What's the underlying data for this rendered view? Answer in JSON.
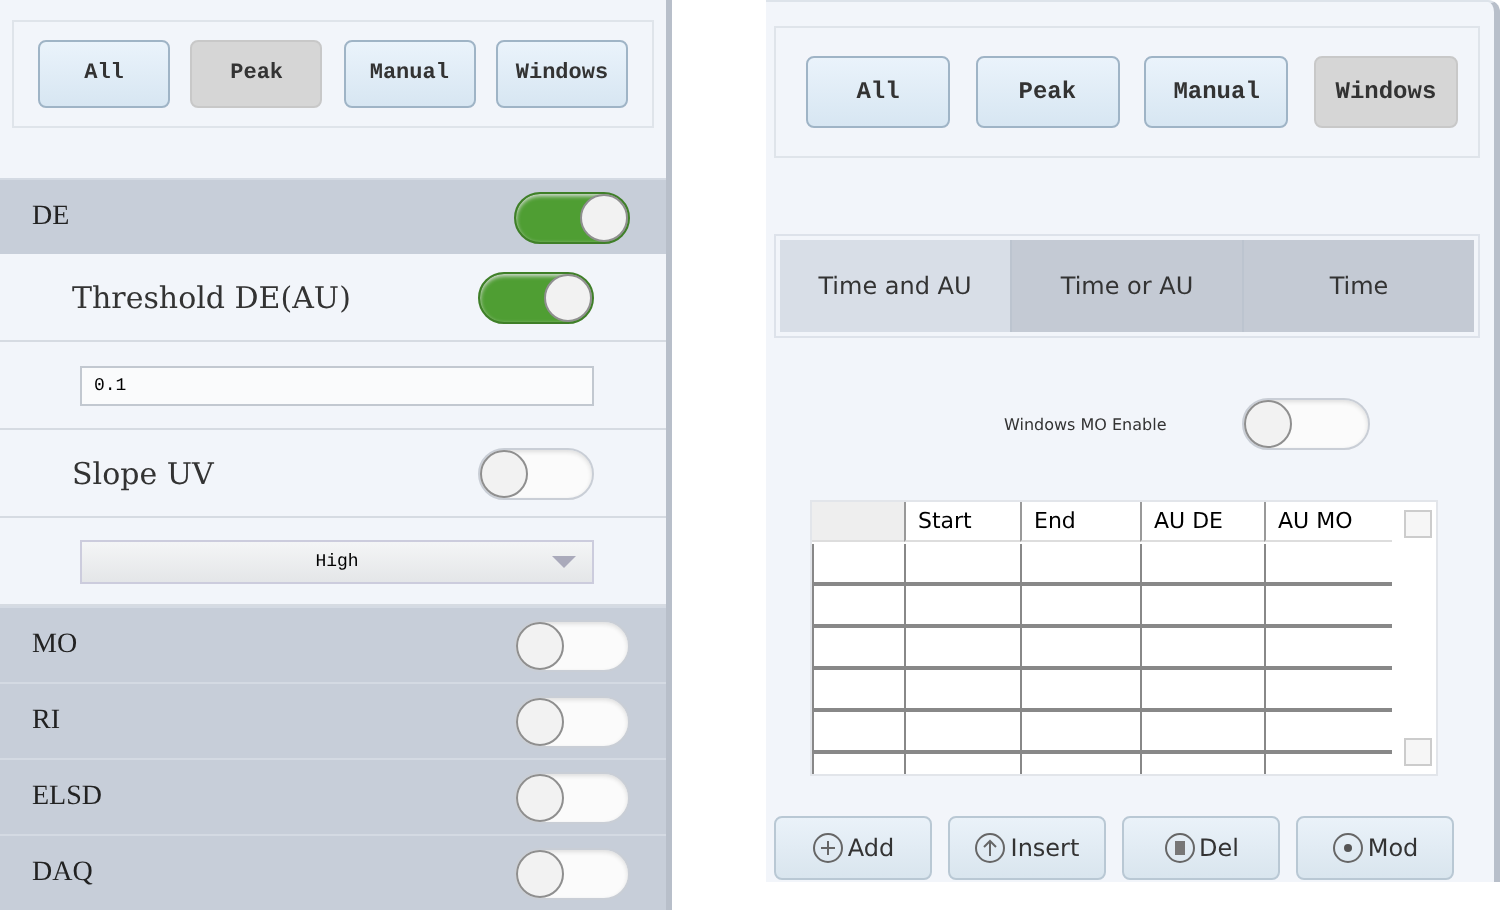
{
  "left_panel": {
    "modes": [
      {
        "label": "All",
        "selected": false
      },
      {
        "label": "Peak",
        "selected": true
      },
      {
        "label": "Manual",
        "selected": false
      },
      {
        "label": "Windows",
        "selected": false
      }
    ],
    "detectors": [
      {
        "name": "DE",
        "on": true,
        "settings": [
          {
            "kind": "toggle",
            "label": "Threshold DE(AU)",
            "on": true
          },
          {
            "kind": "input",
            "value": "0.1"
          },
          {
            "kind": "toggle",
            "label": "Slope UV",
            "on": false
          },
          {
            "kind": "select",
            "value": "High"
          }
        ]
      },
      {
        "name": "MO",
        "on": false
      },
      {
        "name": "RI",
        "on": false
      },
      {
        "name": "ELSD",
        "on": false
      },
      {
        "name": "DAQ",
        "on": false
      }
    ]
  },
  "right_panel": {
    "modes": [
      {
        "label": "All",
        "selected": false
      },
      {
        "label": "Peak",
        "selected": false
      },
      {
        "label": "Manual",
        "selected": false
      },
      {
        "label": "Windows",
        "selected": true
      }
    ],
    "trigger_tabs": [
      {
        "label": "Time and AU",
        "selected": true
      },
      {
        "label": "Time or AU",
        "selected": false
      },
      {
        "label": "Time",
        "selected": false
      }
    ],
    "mo_enable": {
      "label": "Windows MO Enable",
      "on": false
    },
    "table": {
      "columns": [
        "Start",
        "End",
        "AU DE",
        "AU MO"
      ]
    },
    "buttons": [
      {
        "label": "Add",
        "kind": "add"
      },
      {
        "label": "Insert",
        "kind": "insert"
      },
      {
        "label": "Del",
        "kind": "delete"
      },
      {
        "label": "Mod",
        "kind": "modify"
      }
    ]
  }
}
